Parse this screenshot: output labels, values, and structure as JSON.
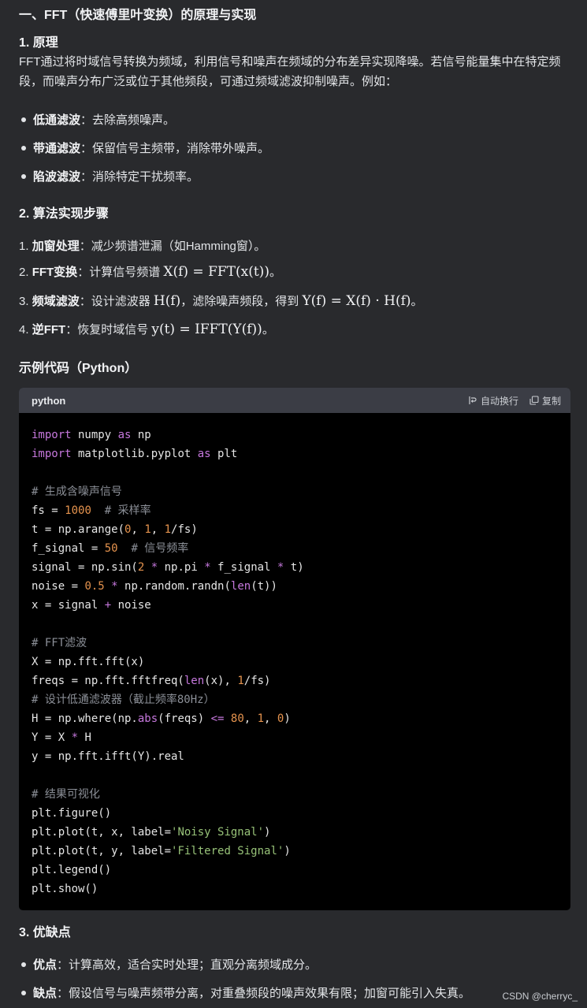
{
  "title": "一、FFT（快速傅里叶变换）的原理与实现",
  "principle": {
    "heading": "1. 原理",
    "paragraph": "FFT通过将时域信号转换为频域，利用信号和噪声在频域的分布差异实现降噪。若信号能量集中在特定频段，而噪声分布广泛或位于其他频段，可通过频域滤波抑制噪声。例如：",
    "bullets": [
      {
        "term": "低通滤波",
        "text": "：去除高频噪声。"
      },
      {
        "term": "带通滤波",
        "text": "：保留信号主频带，消除带外噪声。"
      },
      {
        "term": "陷波滤波",
        "text": "：消除特定干扰频率。"
      }
    ]
  },
  "steps": {
    "heading": "2. 算法实现步骤",
    "items": [
      {
        "num": "1.",
        "term": "加窗处理",
        "text": "：减少频谱泄漏（如Hamming窗）。"
      },
      {
        "num": "2.",
        "term": "FFT变换",
        "text": "：计算信号频谱 ",
        "math": "X(f) = FFT(x(t))",
        "end": "。"
      },
      {
        "num": "3.",
        "term": "频域滤波",
        "text": "：设计滤波器 ",
        "math": "H(f)",
        "mid": "，滤除噪声频段，得到 ",
        "math2": "Y(f) = X(f) · H(f)",
        "end": "。"
      },
      {
        "num": "4.",
        "term": "逆FFT",
        "text": "：恢复时域信号 ",
        "math": "y(t) = IFFT(Y(f))",
        "end": "。"
      }
    ]
  },
  "example": {
    "heading": "示例代码（Python）",
    "lang": "python",
    "wrap_label": "自动换行",
    "copy_label": "复制"
  },
  "pros_cons": {
    "heading": "3. 优缺点",
    "items": [
      {
        "term": "优点",
        "text": "：计算高效，适合实时处理；直观分离频域成分。"
      },
      {
        "term": "缺点",
        "text": "：假设信号与噪声频带分离，对重叠频段的噪声效果有限；加窗可能引入失真。"
      }
    ]
  },
  "watermark": "CSDN @cherryc_",
  "colors": {
    "background": "#292a2d",
    "code_bg": "#000000",
    "keyword": "#c678dd",
    "number": "#e5934e",
    "string": "#98c379",
    "comment": "#8b8f97"
  }
}
